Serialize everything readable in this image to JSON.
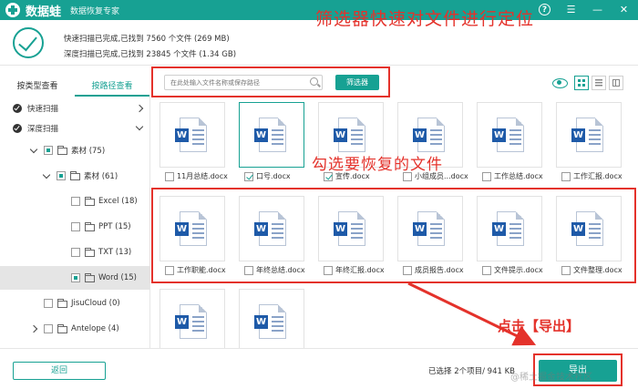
{
  "app": {
    "brand": "数据蛙",
    "subtitle": "数据恢复专家",
    "help_label": "?"
  },
  "status": {
    "quick_scan": "快速扫描已完成,已找到 7560 个文件 (269 MB)",
    "deep_scan": "深度扫描已完成,已找到 23845 个文件 (1.34 GB)"
  },
  "annotations": {
    "filter_note": "筛选器快速对文件进行定位",
    "select_note": "勾选要恢复的文件",
    "export_note": "点击【导出】",
    "watermark": "@稀土掘金技术社区"
  },
  "tabs": [
    {
      "label": "按类型查看",
      "active": false
    },
    {
      "label": "按路径查看",
      "active": true
    }
  ],
  "search": {
    "placeholder": "在此处输入文件名称或保存路径",
    "filter_label": "筛选器"
  },
  "tree": [
    {
      "label": "快速扫描",
      "state": "round-checked",
      "expander": "none",
      "chevron": "right"
    },
    {
      "label": "深度扫描",
      "state": "round-checked",
      "expander": "none",
      "chevron": "down"
    },
    {
      "label": "素材 (75)",
      "state": "partial",
      "expander": "open"
    },
    {
      "label": "素材 (61)",
      "state": "partial",
      "expander": "open"
    },
    {
      "label": "Excel (18)",
      "state": "empty",
      "expander": "none"
    },
    {
      "label": "PPT (15)",
      "state": "empty",
      "expander": "none"
    },
    {
      "label": "TXT (13)",
      "state": "empty",
      "expander": "none"
    },
    {
      "label": "Word (15)",
      "state": "full",
      "expander": "none",
      "selected": true
    },
    {
      "label": "JisuCloud (0)",
      "state": "empty",
      "expander": "none"
    },
    {
      "label": "Antelope (4)",
      "state": "empty",
      "expander": "closed"
    }
  ],
  "files": [
    {
      "name": "11月总结.docx",
      "checked": false,
      "highlight": false
    },
    {
      "name": "口号.docx",
      "checked": true,
      "highlight": true
    },
    {
      "name": "宣传.docx",
      "checked": true,
      "highlight": false
    },
    {
      "name": "小组成员...docx",
      "checked": false,
      "highlight": false
    },
    {
      "name": "工作总结.docx",
      "checked": false,
      "highlight": false
    },
    {
      "name": "工作汇报.docx",
      "checked": false,
      "highlight": false
    },
    {
      "name": "工作职能.docx",
      "checked": false,
      "highlight": false
    },
    {
      "name": "年终总结.docx",
      "checked": false,
      "highlight": false
    },
    {
      "name": "年终汇报.docx",
      "checked": false,
      "highlight": false
    },
    {
      "name": "成员报告.docx",
      "checked": false,
      "highlight": false
    },
    {
      "name": "文件提示.docx",
      "checked": false,
      "highlight": false
    },
    {
      "name": "文件整理.docx",
      "checked": false,
      "highlight": false
    },
    {
      "name": "",
      "checked": false,
      "highlight": false
    },
    {
      "name": "",
      "checked": false,
      "highlight": false
    }
  ],
  "footer": {
    "back_label": "返回",
    "selection_info": "已选择 2个项目/ 941 KB",
    "export_label": "导出"
  },
  "colors": {
    "accent": "#17a193",
    "annotation": "#e4322b",
    "word_blue": "#1e5aa8"
  }
}
